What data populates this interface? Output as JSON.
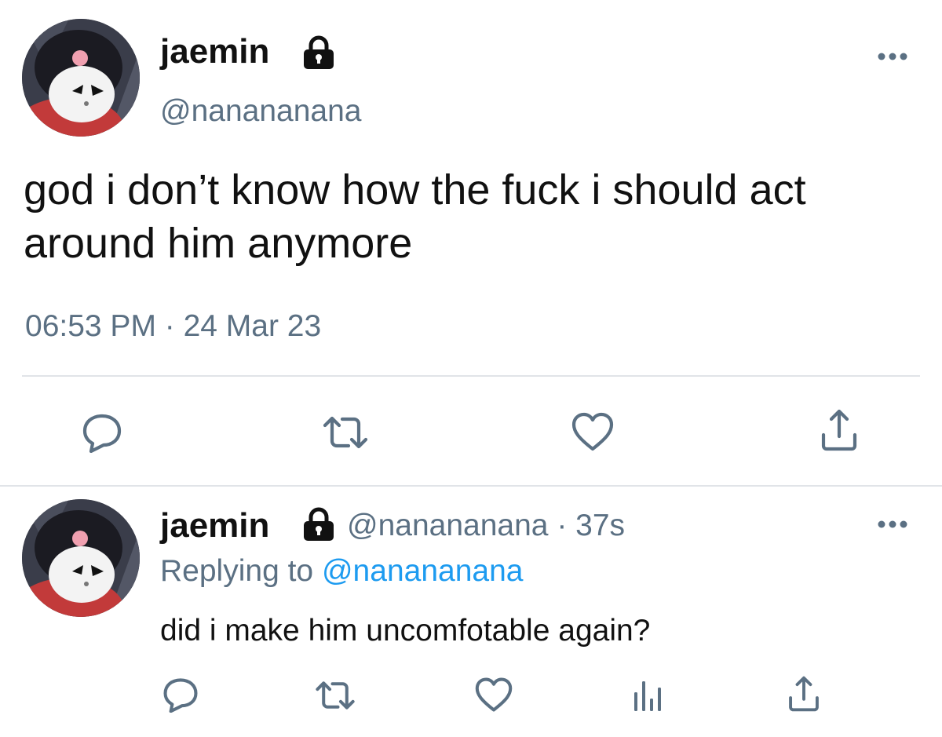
{
  "main_tweet": {
    "display_name": "jaemin",
    "handle": "@nanananana",
    "text": "god i don’t know how the fuck i should act around him anymore",
    "timestamp": "06:53 PM · 24 Mar 23",
    "account_protected_icon": "lock-icon",
    "actions": [
      "reply-icon",
      "retweet-icon",
      "like-icon",
      "share-icon"
    ],
    "more_icon": "more-options-icon"
  },
  "reply_tweet": {
    "display_name": "jaemin",
    "handle_and_time": "@nanananana · 37s",
    "replying_prefix": "Replying to",
    "replying_handle": "@nanananana",
    "text": "did i make him uncomfotable again?",
    "account_protected_icon": "lock-icon",
    "actions": [
      "reply-icon",
      "retweet-icon",
      "like-icon",
      "analytics-icon",
      "share-icon"
    ],
    "more_icon": "more-options-icon"
  },
  "colors": {
    "text_primary": "#111111",
    "text_secondary": "#5b7083",
    "link": "#1d9bf0",
    "divider": "#e1e4e8"
  }
}
